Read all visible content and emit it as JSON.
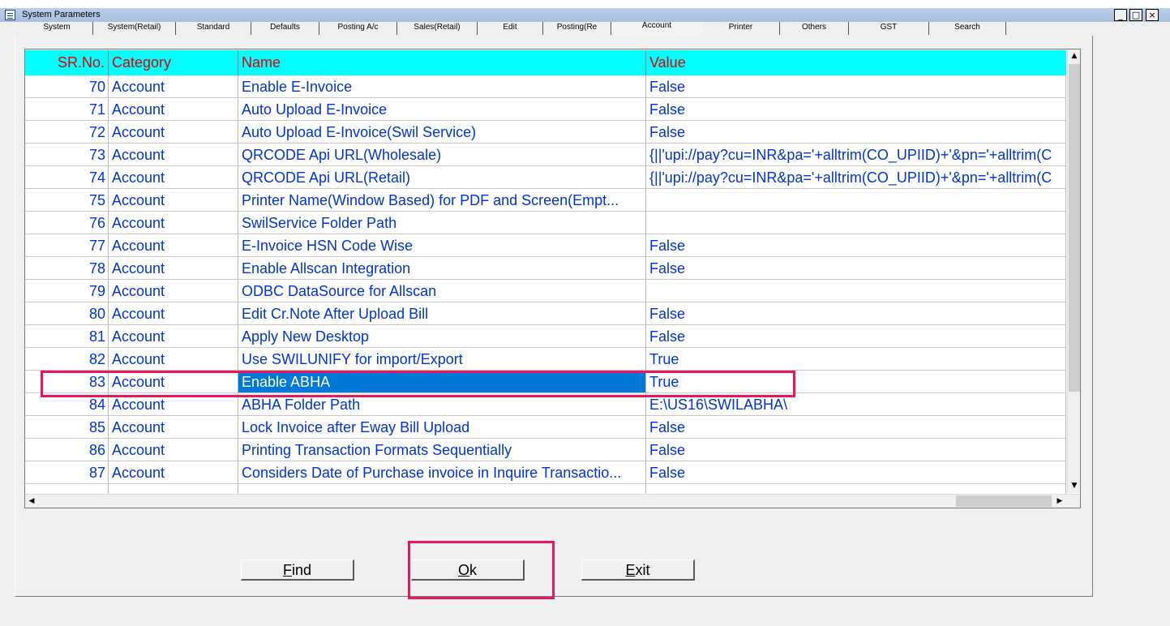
{
  "window": {
    "title": "System Parameters",
    "controls": [
      "_",
      "□",
      "×"
    ]
  },
  "tabs": [
    "System",
    "System(Retail)",
    "Standard",
    "Defaults",
    "Posting A/c",
    "Sales(Retail)",
    "Edit",
    "Posting(Re",
    "Account",
    "Printer",
    "Others",
    "GST",
    "Search"
  ],
  "active_tab": "Account",
  "grid": {
    "columns": [
      "SR.No.",
      "Category",
      "Name",
      "Value"
    ],
    "rows": [
      {
        "sr": "70",
        "category": "Account",
        "name": "Enable E-Invoice",
        "value": "False"
      },
      {
        "sr": "71",
        "category": "Account",
        "name": "Auto Upload E-Invoice",
        "value": "False"
      },
      {
        "sr": "72",
        "category": "Account",
        "name": "Auto Upload E-Invoice(Swil Service)",
        "value": "False"
      },
      {
        "sr": "73",
        "category": "Account",
        "name": "QRCODE Api URL(Wholesale)",
        "value": "{||'upi://pay?cu=INR&pa='+alltrim(CO_UPIID)+'&pn='+alltrim(C"
      },
      {
        "sr": "74",
        "category": "Account",
        "name": "QRCODE Api URL(Retail)",
        "value": "{||'upi://pay?cu=INR&pa='+alltrim(CO_UPIID)+'&pn='+alltrim(C"
      },
      {
        "sr": "75",
        "category": "Account",
        "name": "Printer Name(Window Based) for PDF and Screen(Empt...",
        "value": ""
      },
      {
        "sr": "76",
        "category": "Account",
        "name": "SwilService Folder Path",
        "value": ""
      },
      {
        "sr": "77",
        "category": "Account",
        "name": "E-Invoice HSN Code Wise",
        "value": "False"
      },
      {
        "sr": "78",
        "category": "Account",
        "name": "Enable Allscan Integration",
        "value": "False"
      },
      {
        "sr": "79",
        "category": "Account",
        "name": "ODBC DataSource for Allscan",
        "value": ""
      },
      {
        "sr": "80",
        "category": "Account",
        "name": "Edit Cr.Note After Upload Bill",
        "value": "False"
      },
      {
        "sr": "81",
        "category": "Account",
        "name": "Apply New Desktop",
        "value": "False"
      },
      {
        "sr": "82",
        "category": "Account",
        "name": "Use SWILUNIFY for import/Export",
        "value": "True"
      },
      {
        "sr": "83",
        "category": "Account",
        "name": "Enable ABHA",
        "value": "True",
        "selected": true
      },
      {
        "sr": "84",
        "category": "Account",
        "name": "ABHA Folder Path",
        "value": "E:\\US16\\SWILABHA\\"
      },
      {
        "sr": "85",
        "category": "Account",
        "name": "Lock Invoice after Eway Bill Upload",
        "value": "False"
      },
      {
        "sr": "86",
        "category": "Account",
        "name": "Printing Transaction Formats Sequentially",
        "value": "False"
      },
      {
        "sr": "87",
        "category": "Account",
        "name": "Considers Date of Purchase invoice in Inquire Transactio...",
        "value": "False"
      }
    ]
  },
  "buttons": {
    "find": {
      "hot": "F",
      "rest": "ind"
    },
    "ok": {
      "hot": "O",
      "rest": "k"
    },
    "exit": {
      "hot": "E",
      "rest": "xit"
    }
  },
  "colors": {
    "header_bg": "#00ffff",
    "header_text": "#dd0000",
    "cell_text": "#0033dd",
    "selection": "#0078d7",
    "highlight": "#e8185c"
  }
}
